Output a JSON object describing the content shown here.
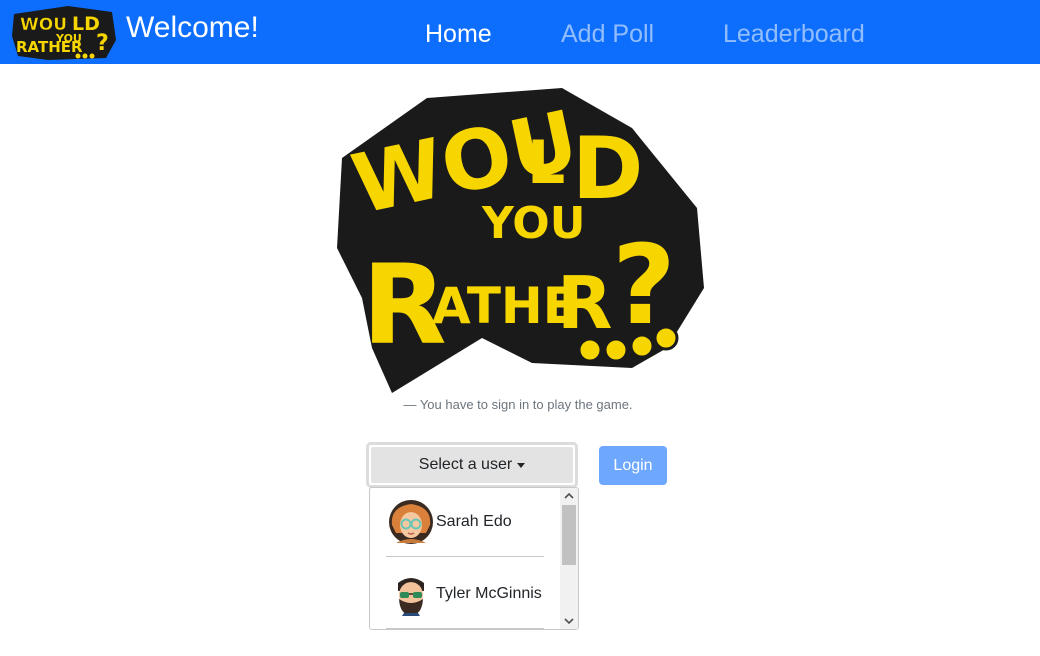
{
  "navbar": {
    "brand": "Welcome!",
    "background": "#0d6efd",
    "links": [
      {
        "label": "Home",
        "active": true
      },
      {
        "label": "Add Poll",
        "active": false
      },
      {
        "label": "Leaderboard",
        "active": false
      }
    ]
  },
  "logo": {
    "words": [
      "WOULD",
      "YOU",
      "RATHER?",
      "...."
    ],
    "fill_color": "#f7d600",
    "outline_color": "#1a1a1a"
  },
  "signin": {
    "tagline": "— You have to sign in to play the game.",
    "select_label": "Select a user",
    "login_label": "Login",
    "login_color": "#6ea8fe"
  },
  "users": [
    {
      "name": "Sarah Edo",
      "avatar_icon": "woman-with-glasses-avatar-icon"
    },
    {
      "name": "Tyler McGinnis",
      "avatar_icon": "bearded-man-with-sunglasses-avatar-icon"
    }
  ],
  "scrollbar": {
    "up_icon": "chevron-up-icon",
    "down_icon": "chevron-down-icon"
  }
}
